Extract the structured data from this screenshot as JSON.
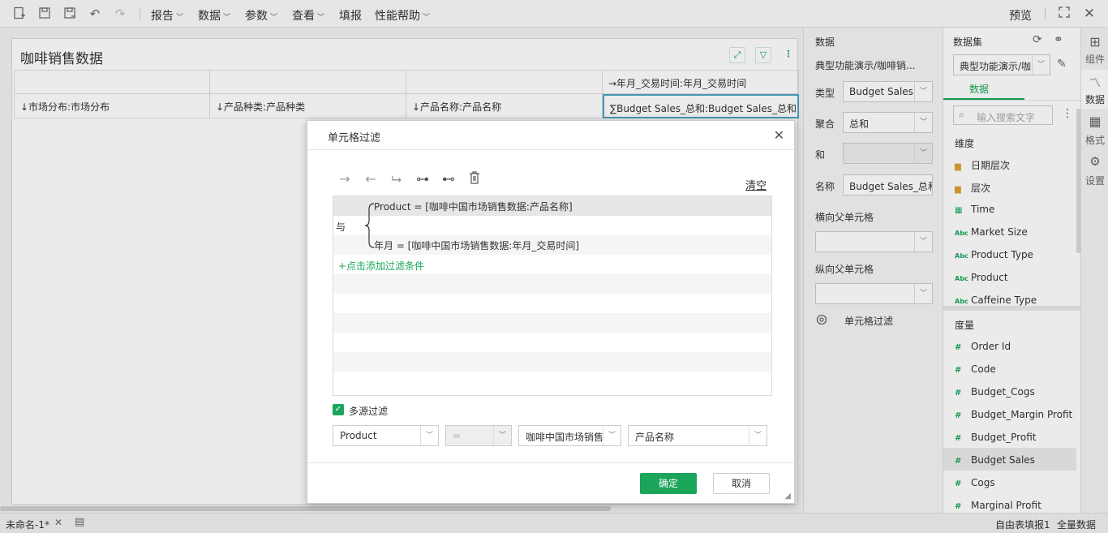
{
  "toolbar": {
    "menus": [
      {
        "label": "报告",
        "has_chevron": true
      },
      {
        "label": "数据",
        "has_chevron": true
      },
      {
        "label": "参数",
        "has_chevron": true
      },
      {
        "label": "查看",
        "has_chevron": true
      },
      {
        "label": "填报",
        "has_chevron": false
      },
      {
        "label": "性能帮助",
        "has_chevron": true
      }
    ],
    "preview_label": "预览",
    "icons": [
      "new-report-icon",
      "save-icon",
      "save-as-icon",
      "undo-icon",
      "redo-icon"
    ]
  },
  "report": {
    "title": "咖啡销售数据",
    "tools": [
      "expand-icon",
      "filter-icon",
      "more-icon"
    ],
    "header_row1": [
      "",
      "",
      "",
      "→年月_交易时间:年月_交易时间"
    ],
    "header_row2": [
      "↓市场分布:市场分布",
      "↓产品种类:产品种类",
      "↓产品名称:产品名称",
      "∑Budget Sales_总和:Budget Sales_总和"
    ]
  },
  "props": {
    "section_title": "数据",
    "dataset_path": "典型功能演示/咖啡销...",
    "type_label": "类型",
    "type_value": "Budget Sales",
    "agg_label": "聚合",
    "agg_value": "总和",
    "and_label": "和",
    "name_label": "名称",
    "name_value": "Budget Sales_总和",
    "h_parent_label": "横向父单元格",
    "v_parent_label": "纵向父单元格",
    "cell_filter_label": "单元格过滤"
  },
  "dataset": {
    "title": "数据集",
    "selected": "典型功能演示/咖",
    "tab": "数据",
    "search_placeholder": "输入搜索文字",
    "dimension_title": "维度",
    "dimensions": [
      {
        "icon": "folder",
        "label": "日期层次"
      },
      {
        "icon": "folder",
        "label": "层次"
      },
      {
        "icon": "calendar",
        "label": "Time"
      },
      {
        "icon": "abc",
        "label": "Market Size"
      },
      {
        "icon": "abc",
        "label": "Product Type"
      },
      {
        "icon": "abc",
        "label": "Product"
      },
      {
        "icon": "abc",
        "label": "Caffeine Type"
      }
    ],
    "measure_title": "度量",
    "measures": [
      "Order Id",
      "Code",
      "Budget_Cogs",
      "Budget_Margin Profit",
      "Budget_Profit",
      "Budget Sales",
      "Cogs",
      "Marginal Profit"
    ],
    "selected_measure": "Budget Sales"
  },
  "sidetabs": [
    "组件",
    "数据",
    "格式",
    "设置"
  ],
  "status": {
    "tab_name": "未命名-1*",
    "right1": "自由表填报1",
    "right2": "全量数据"
  },
  "dialog": {
    "title": "单元格过滤",
    "clear_label": "清空",
    "logic_label": "与",
    "conditions": [
      "Product = [咖啡中国市场销售数据:产品名称]",
      "年月 = [咖啡中国市场销售数据:年月_交易时间]"
    ],
    "add_condition": "+点击添加过滤条件",
    "multi_source_label": "多源过滤",
    "multi_source_checked": true,
    "field_value": "Product",
    "operator_value": "=",
    "source_value": "咖啡中国市场销售",
    "target_value": "产品名称",
    "ok_label": "确定",
    "cancel_label": "取消"
  }
}
